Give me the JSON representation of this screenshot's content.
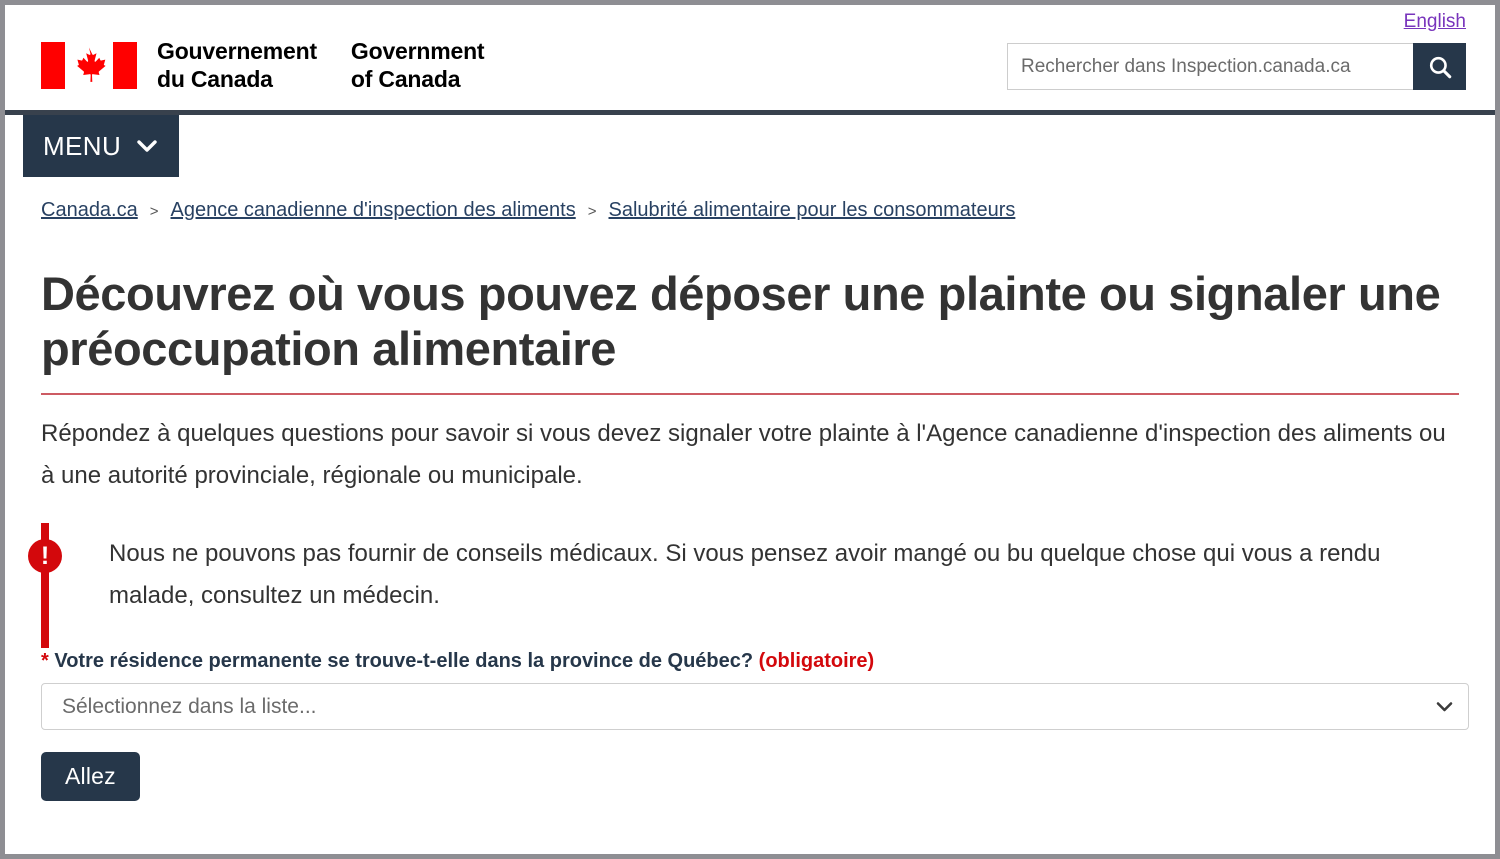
{
  "header": {
    "language_toggle": "English",
    "logo": {
      "icon": "canada-flag-icon",
      "wordmark_fr": "Gouvernement\ndu Canada",
      "wordmark_en": "Government\nof Canada"
    },
    "search": {
      "placeholder": "Rechercher dans Inspection.canada.ca",
      "value": "",
      "button_icon": "search-icon"
    },
    "menu": {
      "label": "MENU",
      "chevron_icon": "chevron-down-icon"
    }
  },
  "breadcrumb": {
    "separator": ">",
    "items": [
      {
        "label": "Canada.ca"
      },
      {
        "label": "Agence canadienne d'inspection des aliments"
      },
      {
        "label": "Salubrité alimentaire pour les consommateurs"
      }
    ]
  },
  "main": {
    "title": "Découvrez où vous pouvez déposer une plainte ou signaler une préoccupation alimentaire",
    "intro": "Répondez à quelques questions pour savoir si vous devez signaler votre plainte à l'Agence canadienne d'inspection des aliments ou à une autorité provinciale, régionale ou municipale.",
    "alert": {
      "icon": "exclamation-circle-icon",
      "icon_glyph": "!",
      "text": "Nous ne pouvons pas fournir de conseils médicaux. Si vous pensez avoir mangé ou bu quelque chose qui vous a rendu malade, consultez un médecin."
    },
    "form": {
      "required_marker": "*",
      "question_label": "Votre résidence permanente se trouve-t-elle dans la province de Québec?",
      "required_note": "(obligatoire)",
      "select": {
        "selected": "Sélectionnez dans la liste...",
        "chevron_icon": "chevron-down-icon",
        "options": [
          "Sélectionnez dans la liste..."
        ]
      },
      "submit_label": "Allez"
    }
  },
  "colors": {
    "brand_navy": "#26374a",
    "alert_red": "#d3080c",
    "title_rule": "#cd5b63",
    "link_blue": "#284162",
    "visited_purple": "#7834bc"
  }
}
